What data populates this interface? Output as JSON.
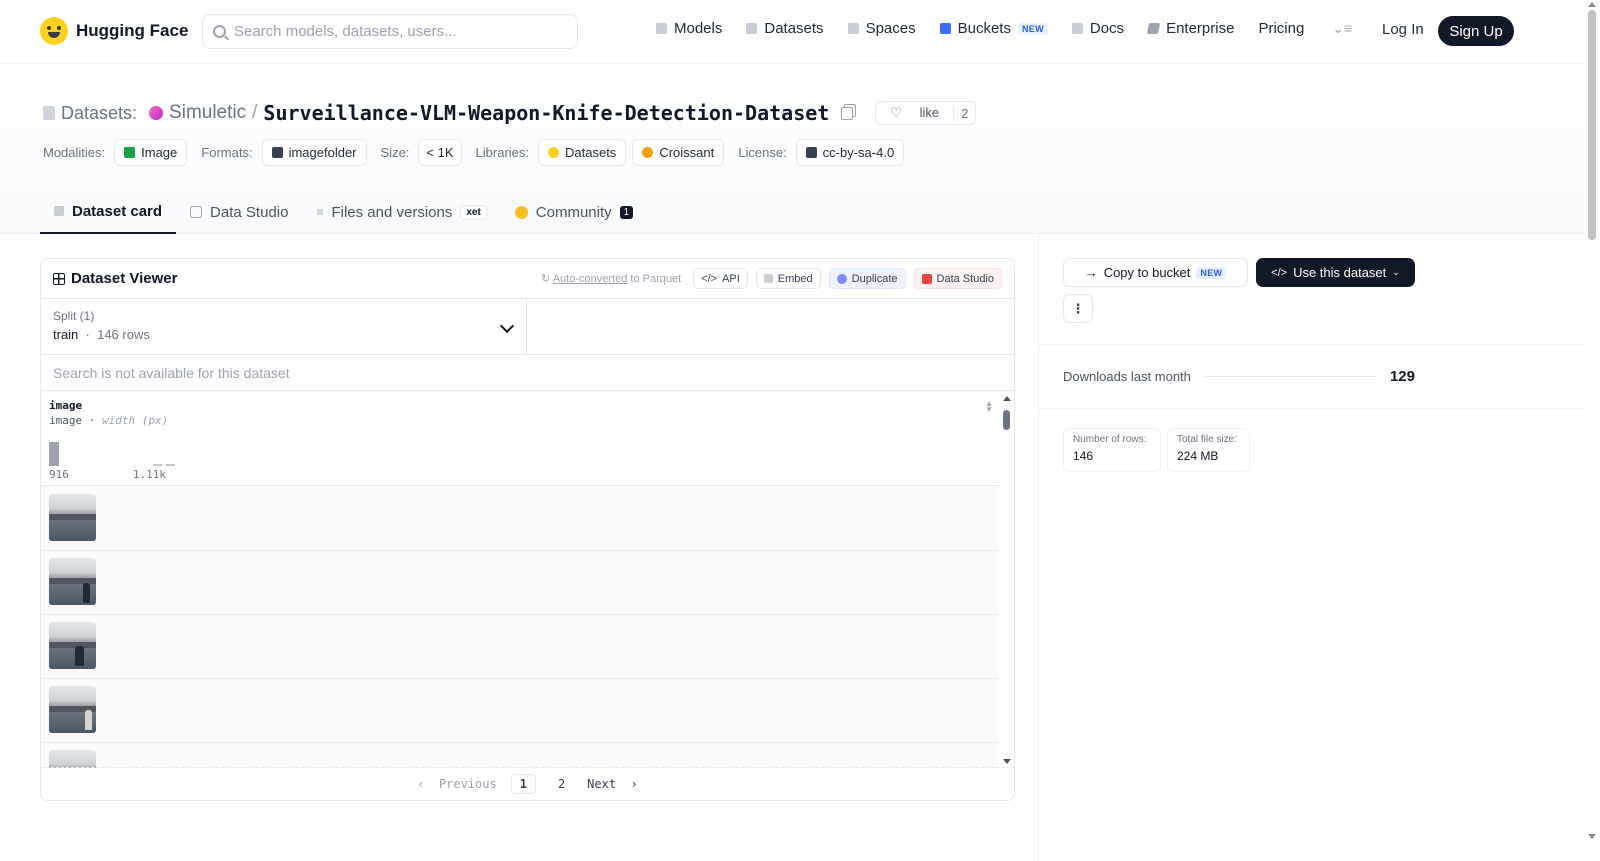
{
  "nav": {
    "brand": "Hugging Face",
    "search_placeholder": "Search models, datasets, users...",
    "items": [
      {
        "label": "Models",
        "icon": "cube-icon"
      },
      {
        "label": "Datasets",
        "icon": "database-icon"
      },
      {
        "label": "Spaces",
        "icon": "grid-icon"
      },
      {
        "label": "Buckets",
        "icon": "bucket-icon",
        "badge": "NEW"
      },
      {
        "label": "Docs",
        "icon": "book-icon"
      },
      {
        "label": "Enterprise",
        "icon": "enterprise-icon"
      },
      {
        "label": "Pricing"
      }
    ],
    "login": "Log In",
    "signup": "Sign Up"
  },
  "header": {
    "section": "Datasets:",
    "org": "Simuletic",
    "slash": "/",
    "dataset": "Surveillance-VLM-Weapon-Knife-Detection-Dataset",
    "like_label": "like",
    "like_count": "2",
    "meta": {
      "modalities_label": "Modalities:",
      "modality": "Image",
      "formats_label": "Formats:",
      "format": "imagefolder",
      "size_label": "Size:",
      "size": "< 1K",
      "libraries_label": "Libraries:",
      "lib1": "Datasets",
      "lib2": "Croissant",
      "license_label": "License:",
      "license": "cc-by-sa-4.0"
    }
  },
  "tabs": {
    "card": "Dataset card",
    "studio": "Data Studio",
    "files": "Files and versions",
    "xet": "xet",
    "community": "Community",
    "community_count": "1"
  },
  "viewer": {
    "title": "Dataset Viewer",
    "auto_prefix": "Auto-converted",
    "auto_suffix": " to Parquet",
    "api": "API",
    "embed": "Embed",
    "duplicate": "Duplicate",
    "data_studio": "Data Studio",
    "split_label": "Split (1)",
    "split_value": "train",
    "split_rows": "146 rows",
    "search_disabled": "Search is not available for this dataset",
    "column": {
      "name": "image",
      "type": "image",
      "stat": "width (px)",
      "min": "916",
      "max": "1.11k"
    },
    "histogram": [
      0.92,
      0,
      0,
      0,
      0,
      0,
      0,
      0,
      0.05,
      0.05
    ],
    "pager": {
      "prev": "Previous",
      "pages": [
        "1",
        "2"
      ],
      "current": "1",
      "next": "Next"
    }
  },
  "sidebar": {
    "copy_bucket": "Copy to bucket",
    "new_badge": "NEW",
    "use_dataset": "Use this dataset",
    "downloads_label": "Downloads last month",
    "downloads": "129",
    "rows_label": "Number of rows:",
    "rows": "146",
    "size_label": "Total file size:",
    "size": "224 MB"
  },
  "colors": {
    "accent": "#111827",
    "brand_yellow": "#ffd21e",
    "org_pink": "#e056c8"
  }
}
